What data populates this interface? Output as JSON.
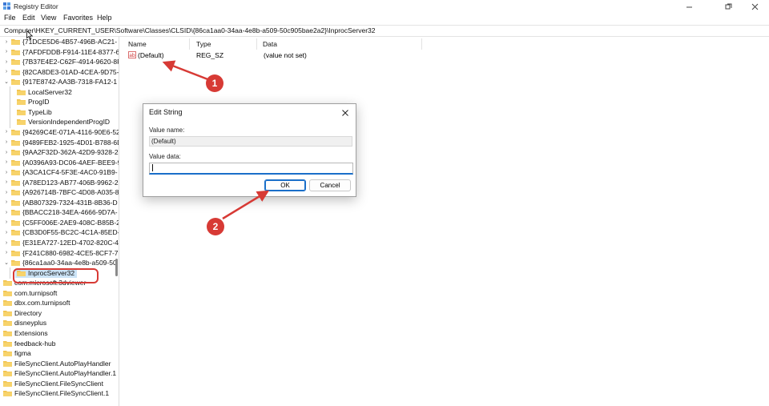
{
  "window": {
    "title": "Registry Editor"
  },
  "menu": [
    "File",
    "Edit",
    "View",
    "Favorites",
    "Help"
  ],
  "address": "Computer\\HKEY_CURRENT_USER\\Software\\Classes\\CLSID\\{86ca1aa0-34aa-4e8b-a509-50c905bae2a2}\\InprocServer32",
  "tree": [
    {
      "label": "{71DCE5D6-4B57-496B-AC21-",
      "indent": 0,
      "expandable": true
    },
    {
      "label": "{7AFDFDDB-F914-11E4-8377-6",
      "indent": 0,
      "expandable": true
    },
    {
      "label": "{7B37E4E2-C62F-4914-9620-8F",
      "indent": 0,
      "expandable": true
    },
    {
      "label": "{82CA8DE3-01AD-4CEA-9D75-",
      "indent": 0,
      "expandable": true
    },
    {
      "label": "{917E8742-AA3B-7318-FA12-1",
      "indent": 0,
      "expandable": true,
      "expanded": true
    },
    {
      "label": "LocalServer32",
      "indent": 1,
      "expandable": false
    },
    {
      "label": "ProgID",
      "indent": 1,
      "expandable": false
    },
    {
      "label": "TypeLib",
      "indent": 1,
      "expandable": false
    },
    {
      "label": "VersionIndependentProgID",
      "indent": 1,
      "expandable": false
    },
    {
      "label": "{94269C4E-071A-4116-90E6-52",
      "indent": 0,
      "expandable": true
    },
    {
      "label": "{9489FEB2-1925-4D01-B788-6D",
      "indent": 0,
      "expandable": true
    },
    {
      "label": "{9AA2F32D-362A-42D9-9328-2",
      "indent": 0,
      "expandable": true
    },
    {
      "label": "{A0396A93-DC06-4AEF-BEE9-9",
      "indent": 0,
      "expandable": true
    },
    {
      "label": "{A3CA1CF4-5F3E-4AC0-91B9-",
      "indent": 0,
      "expandable": true
    },
    {
      "label": "{A78ED123-AB77-406B-9962-2",
      "indent": 0,
      "expandable": true
    },
    {
      "label": "{A926714B-7BFC-4D08-A035-8",
      "indent": 0,
      "expandable": true
    },
    {
      "label": "{AB807329-7324-431B-8B36-D",
      "indent": 0,
      "expandable": true
    },
    {
      "label": "{BBACC218-34EA-4666-9D7A-",
      "indent": 0,
      "expandable": true
    },
    {
      "label": "{C5FF006E-2AE9-408C-B85B-2",
      "indent": 0,
      "expandable": true
    },
    {
      "label": "{CB3D0F55-BC2C-4C1A-85ED-",
      "indent": 0,
      "expandable": true
    },
    {
      "label": "{E31EA727-12ED-4702-820C-4",
      "indent": 0,
      "expandable": true
    },
    {
      "label": "{F241C880-6982-4CE5-8CF7-7",
      "indent": 0,
      "expandable": true
    },
    {
      "label": "{86ca1aa0-34aa-4e8b-a509-50",
      "indent": 0,
      "expandable": true,
      "expanded": true
    },
    {
      "label": "InprocServer32",
      "indent": 1,
      "expandable": false,
      "selected": true
    },
    {
      "label": "com.microsoft.3dviewer",
      "indent": -1,
      "expandable": true
    },
    {
      "label": "com.turnipsoft",
      "indent": -1,
      "expandable": true
    },
    {
      "label": "dbx.com.turnipsoft",
      "indent": -1,
      "expandable": true
    },
    {
      "label": "Directory",
      "indent": -1,
      "expandable": true
    },
    {
      "label": "disneyplus",
      "indent": -1,
      "expandable": true
    },
    {
      "label": "Extensions",
      "indent": -1,
      "expandable": true
    },
    {
      "label": "feedback-hub",
      "indent": -1,
      "expandable": true
    },
    {
      "label": "figma",
      "indent": -1,
      "expandable": true
    },
    {
      "label": "FileSyncClient.AutoPlayHandler",
      "indent": -1,
      "expandable": true
    },
    {
      "label": "FileSyncClient.AutoPlayHandler.1",
      "indent": -1,
      "expandable": true
    },
    {
      "label": "FileSyncClient.FileSyncClient",
      "indent": -1,
      "expandable": true
    },
    {
      "label": "FileSyncClient.FileSyncClient.1",
      "indent": -1,
      "expandable": true
    }
  ],
  "list": {
    "headers": {
      "name": "Name",
      "type": "Type",
      "data": "Data"
    },
    "rows": [
      {
        "icon": "ab",
        "name": "(Default)",
        "type": "REG_SZ",
        "data": "(value not set)"
      }
    ]
  },
  "dialog": {
    "title": "Edit String",
    "value_name_label": "Value name:",
    "value_name": "(Default)",
    "value_data_label": "Value data:",
    "value_data": "",
    "ok": "OK",
    "cancel": "Cancel"
  },
  "annotations": {
    "step1": "1",
    "step2": "2"
  },
  "colors": {
    "annotation": "#d73a35",
    "accent": "#1a6fc9",
    "folder": "#f0c04a"
  }
}
